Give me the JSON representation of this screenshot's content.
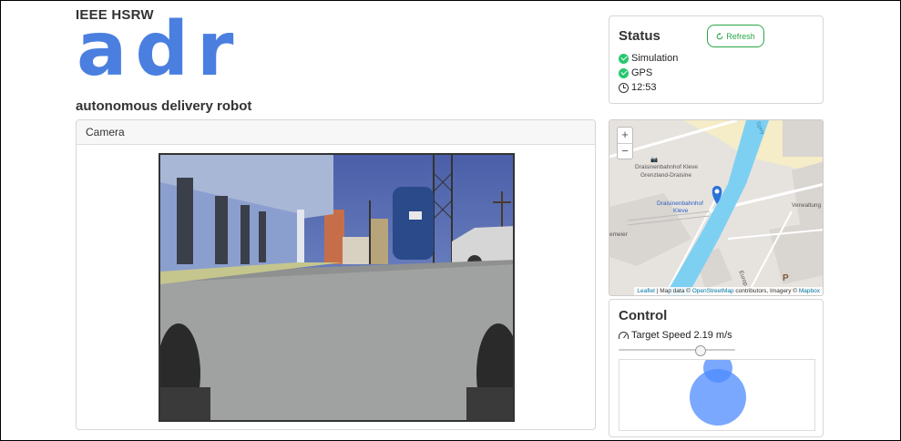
{
  "header": {
    "org": "IEEE HSRW",
    "logo": "adr",
    "subtitle": "autonomous delivery robot"
  },
  "camera": {
    "label": "Camera"
  },
  "status": {
    "title": "Status",
    "refresh_label": "Refresh",
    "items": [
      {
        "label": "Simulation",
        "icon": "check-circle-icon"
      },
      {
        "label": "GPS",
        "icon": "check-circle-icon"
      },
      {
        "label": "12:53",
        "icon": "clock-icon"
      }
    ]
  },
  "map": {
    "zoom_in": "+",
    "zoom_out": "−",
    "labels": {
      "station": "Draisinenbahnhof Kleve",
      "station_sub": "Grenzland-Draisine",
      "stop": "Draisinenbahnhof",
      "stop_sub": "Kleve",
      "street1": "emeier",
      "street2": "Verwaltung",
      "river": "Spoy",
      "street3": "Europ",
      "parking": "P"
    },
    "attribution": {
      "leaflet": "Leaflet",
      "text1": " | Map data © ",
      "osm": "OpenStreetMap",
      "text2": " contributors, Imagery © ",
      "mapbox": "Mapbox"
    }
  },
  "control": {
    "title": "Control",
    "speed_label": "Target Speed",
    "speed_value": "2.19 m/s",
    "speed_fraction": 0.7
  },
  "colors": {
    "accent": "#4a7fe0",
    "success": "#28a745",
    "joystick": "#4e8bff"
  }
}
